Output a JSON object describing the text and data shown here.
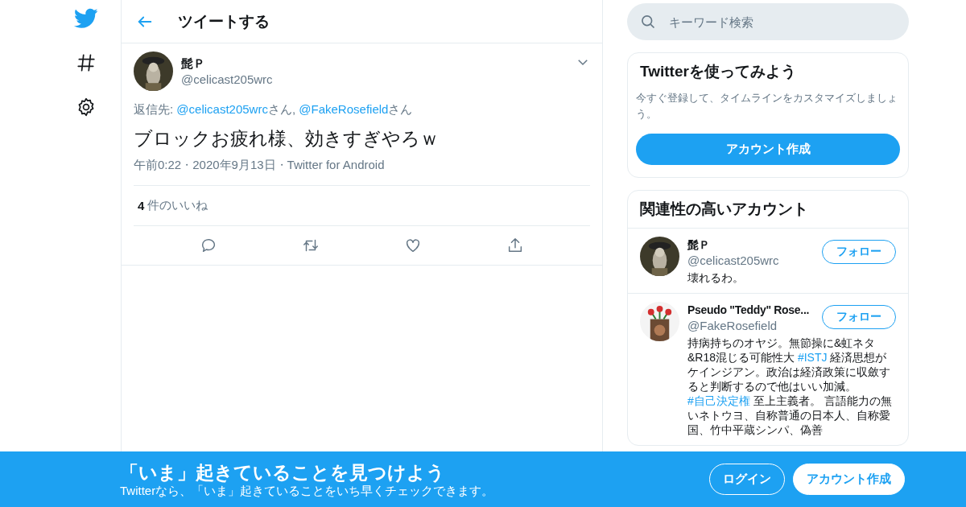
{
  "nav": [
    {
      "kind": "logo"
    },
    {
      "kind": "explore"
    },
    {
      "kind": "settings"
    }
  ],
  "header": {
    "title": "ツイートする"
  },
  "tweet": {
    "name": "髭Ｐ",
    "handle": "@celicast205wrc",
    "reply_to": [
      {
        "kind": "text",
        "text": "返信先: "
      },
      {
        "kind": "link",
        "text": "@celicast205wrc"
      },
      {
        "kind": "text",
        "text": "さん, "
      },
      {
        "kind": "link",
        "text": "@FakeRosefield"
      },
      {
        "kind": "text",
        "text": "さん"
      }
    ],
    "text": "ブロックお疲れ様、効きすぎやろｗ",
    "meta": [
      {
        "kind": "text",
        "text": "午前0:22"
      },
      {
        "kind": "separator",
        "text": "・"
      },
      {
        "kind": "text",
        "text": "2020年9月13日"
      },
      {
        "kind": "separator",
        "text": "・"
      },
      {
        "kind": "text",
        "text": "Twitter for Android"
      }
    ],
    "likes_count": "4",
    "likes_label": "件のいいね",
    "actions": [
      {
        "kind": "reply"
      },
      {
        "kind": "retweet"
      },
      {
        "kind": "like"
      },
      {
        "kind": "share"
      }
    ]
  },
  "search": {
    "placeholder": "キーワード検索"
  },
  "signup_card": {
    "title": "Twitterを使ってみよう",
    "text": "今すぐ登録して、タイムラインをカスタマイズしましょう。",
    "button": "アカウント作成"
  },
  "related": {
    "title": "関連性の高いアカウント",
    "accounts": [
      {
        "name": "髭Ｐ",
        "handle": "@celicast205wrc",
        "follow": "フォロー",
        "bio": [
          {
            "kind": "text",
            "text": "壊れるわ。"
          }
        ]
      },
      {
        "name": "Pseudo \"Teddy\" Rose...",
        "handle": "@FakeRosefield",
        "follow": "フォロー",
        "bio": [
          {
            "kind": "text",
            "text": "持病持ちのオヤジ。無節操に&虹ネタ&R18混じる可能性大 "
          },
          {
            "kind": "hashtag",
            "text": "#ISTJ"
          },
          {
            "kind": "text",
            "text": " 経済思想がケインジアン。政治は経済政策に収斂すると判断するので他はいい加減。"
          },
          {
            "kind": "hashtag",
            "text": "#自己決定権"
          },
          {
            "kind": "text",
            "text": " 至上主義者。 言語能力の無いネトウヨ、自称普通の日本人、自称愛国、竹中平蔵シンパ、偽善"
          }
        ]
      }
    ]
  },
  "banner": {
    "title": "「いま」起きていることを見つけよう",
    "subtitle": "Twitterなら、「いま」起きていることをいち早くチェックできます。",
    "login": "ログイン",
    "signup": "アカウント作成"
  }
}
